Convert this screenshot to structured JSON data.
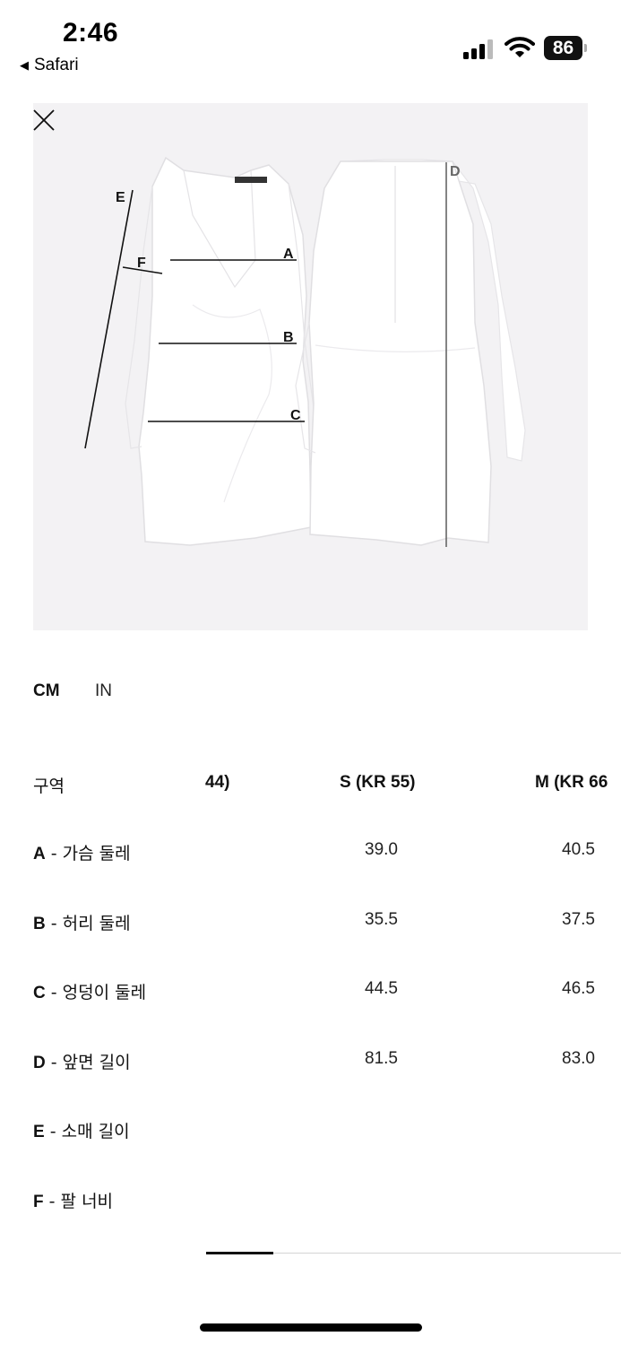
{
  "status_bar": {
    "time": "2:46",
    "back_label": "Safari",
    "battery_level": "86"
  },
  "diagram": {
    "labels": [
      "A",
      "B",
      "C",
      "D",
      "E",
      "F"
    ]
  },
  "units": {
    "cm": "CM",
    "in": "IN",
    "selected": "CM"
  },
  "table": {
    "area_header": "구역",
    "columns": [
      "44)",
      "S (KR 55)",
      "M (KR 66"
    ],
    "rows": [
      {
        "code": "A",
        "name": " - 가슴 둘레",
        "s": "39.0",
        "m": "40.5"
      },
      {
        "code": "B",
        "name": " - 허리 둘레",
        "s": "35.5",
        "m": "37.5"
      },
      {
        "code": "C",
        "name": " - 엉덩이 둘레",
        "s": "44.5",
        "m": "46.5"
      },
      {
        "code": "D",
        "name": " - 앞면 길이",
        "s": "81.5",
        "m": "83.0"
      },
      {
        "code": "E",
        "name": " - 소매 길이",
        "s": "",
        "m": ""
      },
      {
        "code": "F",
        "name": " - 팔 너비",
        "s": "",
        "m": ""
      }
    ]
  },
  "icons": {
    "back": "back-triangle-icon",
    "close": "close-icon",
    "signal": "cellular-signal-icon",
    "wifi": "wifi-icon",
    "battery": "battery-icon"
  }
}
